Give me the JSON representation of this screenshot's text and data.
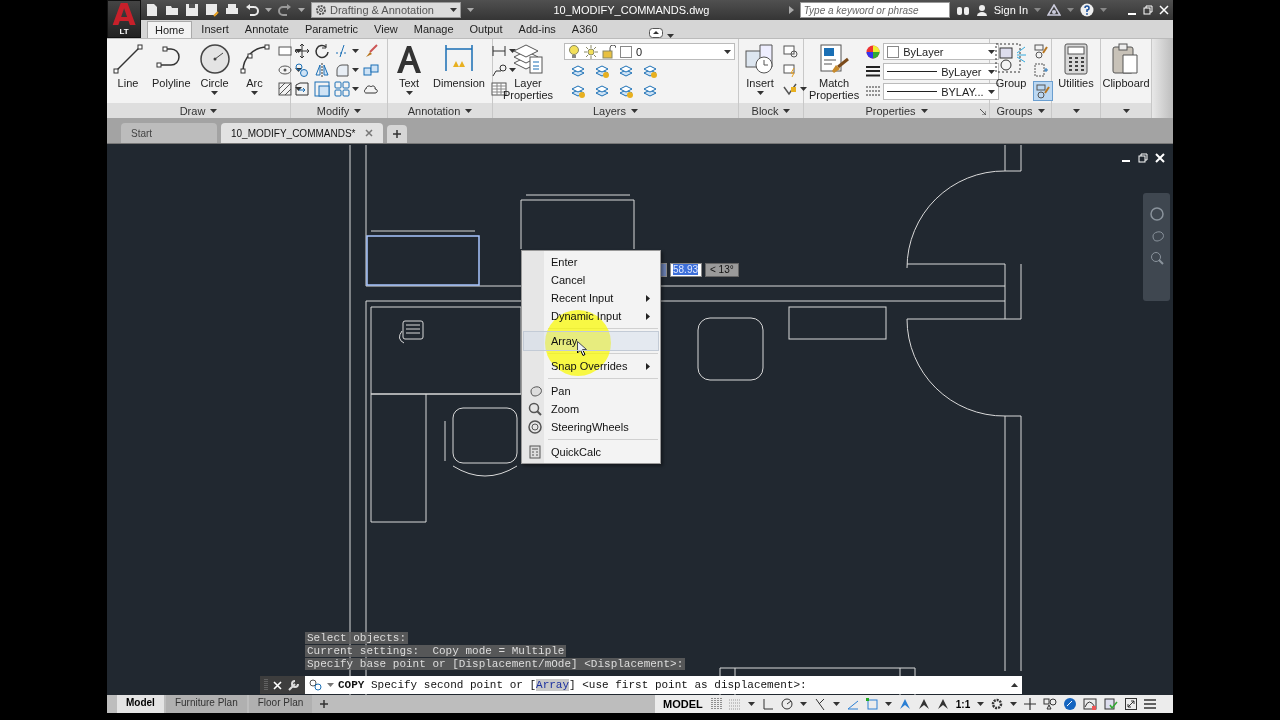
{
  "title_bar": {
    "app_letter": "A",
    "app_edition": "LT",
    "workspace": "Drafting & Annotation",
    "file_name": "10_MODIFY_COMMANDS.dwg",
    "search": {
      "placeholder": "Type a keyword or phrase"
    },
    "sign_in": "Sign In"
  },
  "ribbon_tabs": [
    {
      "label": "Home",
      "selected": true
    },
    {
      "label": "Insert",
      "selected": false
    },
    {
      "label": "Annotate",
      "selected": false
    },
    {
      "label": "Parametric",
      "selected": false
    },
    {
      "label": "View",
      "selected": false
    },
    {
      "label": "Manage",
      "selected": false
    },
    {
      "label": "Output",
      "selected": false
    },
    {
      "label": "Add-ins",
      "selected": false
    },
    {
      "label": "A360",
      "selected": false
    }
  ],
  "panels": [
    {
      "kind": "draw",
      "title": "Draw",
      "tools": [
        {
          "label": "Line",
          "dropdown": false
        },
        {
          "label": "Polyline",
          "dropdown": false
        },
        {
          "label": "Circle",
          "dropdown": true
        },
        {
          "label": "Arc",
          "dropdown": true
        }
      ]
    },
    {
      "kind": "modify",
      "title": "Modify"
    },
    {
      "kind": "annotation",
      "title": "Annotation",
      "tools": [
        {
          "label": "Text",
          "dropdown": true
        },
        {
          "label": "Dimension",
          "dropdown": false
        }
      ]
    },
    {
      "kind": "layers",
      "title": "Layers",
      "tools": [
        {
          "label": "Layer Properties",
          "dropdown": false
        }
      ],
      "layer": "0"
    },
    {
      "kind": "block",
      "title": "Block",
      "tools": [
        {
          "label": "Insert",
          "dropdown": true
        }
      ]
    },
    {
      "kind": "properties",
      "title": "Properties",
      "tools": [
        {
          "label": "Match Properties",
          "dropdown": false
        }
      ],
      "color_control": "ByLayer",
      "lineweight": "ByLayer",
      "linetype": "BYLAY..."
    },
    {
      "kind": "groups",
      "title": "Groups",
      "tools": [
        {
          "label": "Group",
          "dropdown": false
        }
      ]
    },
    {
      "kind": "utilities",
      "tools": [
        {
          "label": "Utilities",
          "dropdown": false
        }
      ]
    },
    {
      "kind": "clipboard",
      "tools": [
        {
          "label": "Clipboard",
          "dropdown": false
        }
      ]
    }
  ],
  "doc_tabs": [
    {
      "label": "Start",
      "selected": false
    },
    {
      "label": "10_MODIFY_COMMANDS*",
      "selected": true
    }
  ],
  "canvas": {
    "dynamic_input": {
      "distance": "58.93",
      "angle": "< 13°"
    },
    "context_menu": {
      "groups": [
        [
          {
            "label": "Enter",
            "submenu": false,
            "selected": false
          },
          {
            "label": "Cancel",
            "submenu": false,
            "selected": false
          },
          {
            "label": "Recent Input",
            "submenu": true,
            "selected": false
          },
          {
            "label": "Dynamic Input",
            "submenu": true,
            "selected": false
          }
        ],
        [
          {
            "label": "Array",
            "submenu": false,
            "selected": true
          }
        ],
        [
          {
            "label": "Snap Overrides",
            "submenu": true,
            "selected": false
          }
        ],
        [
          {
            "label": "Pan",
            "submenu": false,
            "selected": false
          },
          {
            "label": "Zoom",
            "submenu": false,
            "selected": false
          },
          {
            "label": "SteeringWheels",
            "submenu": false,
            "selected": false
          }
        ],
        [
          {
            "label": "QuickCalc",
            "submenu": false,
            "selected": false
          }
        ]
      ]
    },
    "history": [
      "Select objects:",
      "Current settings:  Copy mode = Multiple",
      "Specify base point or [Displacement/mOde] <Displacement>:"
    ],
    "command_line": {
      "command": "COPY",
      "prompt": [
        {
          "kind": "text",
          "text": "Specify second point or ["
        },
        {
          "kind": "option",
          "text": "Array"
        },
        {
          "kind": "text",
          "text": "] <use first point as displacement>:"
        }
      ]
    }
  },
  "layout_tabs": [
    {
      "label": "Model",
      "selected": true
    },
    {
      "label": "Furniture Plan",
      "selected": false
    },
    {
      "label": "Floor Plan",
      "selected": false
    }
  ],
  "status_bar": {
    "space": "MODEL",
    "scale": "1:1"
  }
}
